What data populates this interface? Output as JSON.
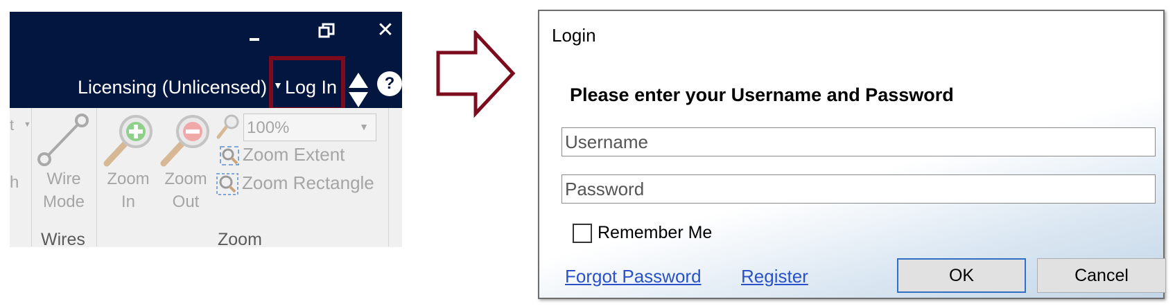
{
  "app": {
    "window_controls": {
      "minimize": "minimize",
      "restore": "restore",
      "close": "✕"
    },
    "licensing_label": "Licensing (Unlicensed)",
    "login_label": "Log In",
    "help_label": "?",
    "ribbon": {
      "cut_left_top": "t",
      "cut_left_bottom": "h",
      "wire_mode": {
        "line1": "Wire",
        "line2": "Mode"
      },
      "zoom_in": {
        "line1": "Zoom",
        "line2": "In"
      },
      "zoom_out": {
        "line1": "Zoom",
        "line2": "Out"
      },
      "zoom_level": "100%",
      "zoom_extent": "Zoom Extent",
      "zoom_rectangle": "Zoom Rectangle",
      "groups": {
        "wires": "Wires",
        "zoom": "Zoom"
      }
    }
  },
  "dialog": {
    "title": "Login",
    "heading": "Please enter your Username and Password",
    "username": {
      "value": "",
      "placeholder": "Username"
    },
    "password": {
      "value": "",
      "placeholder": "Password"
    },
    "remember_me": {
      "label": "Remember Me",
      "checked": false
    },
    "forgot_password": "Forgot Password",
    "register": "Register",
    "ok": "OK",
    "cancel": "Cancel"
  },
  "colors": {
    "titlebar": "#031640",
    "highlight": "#7b0b1d",
    "arrow": "#7b0b1d",
    "link": "#2952c8",
    "ribbon_disabled": "#a5a5a5"
  },
  "icons": [
    "minimize-icon",
    "restore-icon",
    "close-icon",
    "dropdown-caret-icon",
    "spinner-icon",
    "help-icon",
    "wire-mode-icon",
    "zoom-in-icon",
    "zoom-out-icon",
    "zoom-extent-icon",
    "zoom-rectangle-icon",
    "arrow-right-icon",
    "checkbox-icon"
  ]
}
